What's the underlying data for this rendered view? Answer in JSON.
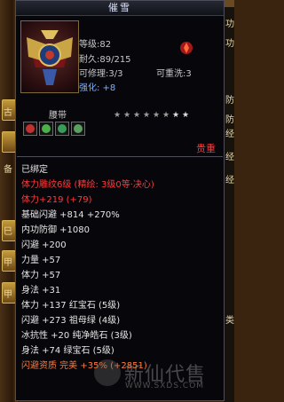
{
  "background": {
    "left_tag_chars": [
      "古",
      "备",
      "巳",
      "甲",
      "甲"
    ],
    "right_chars": [
      "功",
      "功",
      "防",
      "防",
      "经",
      "经",
      "经",
      "类"
    ]
  },
  "tooltip": {
    "title": "催雪",
    "level": "等级:82",
    "durability": "耐久:89/215",
    "repairable": "可修理:3/3",
    "rewashable": "可重洗:3",
    "strengthen": "强化: +8",
    "sub_name": "腰带",
    "stars": [
      "★",
      "★",
      "★",
      "★",
      "★",
      "★",
      "★",
      "★"
    ],
    "noble": "贵重",
    "gem_colors": [
      "#c23030",
      "#4ab04a",
      "#3a9a5a",
      "#5aa060"
    ],
    "lines": [
      {
        "text": "已绑定",
        "color": "white"
      },
      {
        "text": "体力雕纹6级 (精绘: 3级0等·决心)",
        "color": "red"
      },
      {
        "text": "体力+219 (+79)",
        "color": "red"
      },
      {
        "text": "基础闪避 +814 +270%",
        "color": "white"
      },
      {
        "text": "内功防御 +1080",
        "color": "white"
      },
      {
        "text": "闪避 +200",
        "color": "white"
      },
      {
        "text": "力量 +57",
        "color": "white"
      },
      {
        "text": "体力 +57",
        "color": "white"
      },
      {
        "text": "身法 +31",
        "color": "white"
      },
      {
        "text": "体力 +137 红宝石 (5级)",
        "color": "white"
      },
      {
        "text": "闪避 +273 祖母绿 (4级)",
        "color": "white"
      },
      {
        "text": "冰抗性 +20 纯净皓石 (3级)",
        "color": "white"
      },
      {
        "text": "身法 +74 绿宝石 (5级)",
        "color": "white"
      },
      {
        "text": "闪避资质  完美  +35% (+2851)",
        "color": "orange"
      }
    ]
  },
  "watermark": {
    "text": "新仙代售",
    "url": "WWW.SXDS.COM"
  }
}
